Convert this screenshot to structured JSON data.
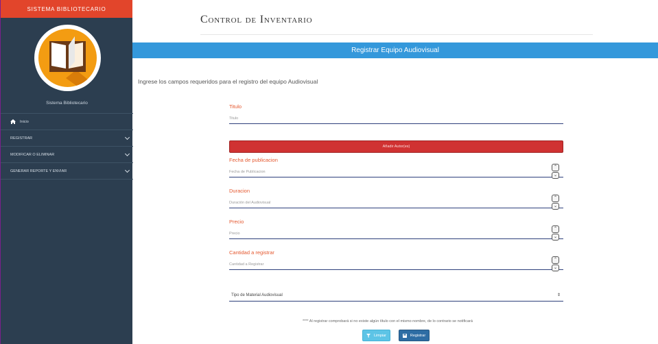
{
  "sidebar": {
    "header": "SISTEMA BIBLIOTECARIO",
    "caption": "Sistema Bibliotecario",
    "items": [
      {
        "label": "Inicio"
      },
      {
        "label": "REGISTRAR"
      },
      {
        "label": "MODIFICAR O ELIMINAR"
      },
      {
        "label": "GENERAR REPORTE Y ENVIAR"
      }
    ]
  },
  "header": {
    "title": "Control de Inventario"
  },
  "banner": {
    "title": "Registrar Equipo Audiovisual"
  },
  "form": {
    "intro": "Ingrese los campos requeridos para el registro del equipo Audiovisual",
    "titulo": {
      "label": "Titulo",
      "placeholder": "Titulo"
    },
    "add_author": "Añadir Autor(es)",
    "fecha": {
      "label": "Fecha de publicacion",
      "placeholder": "Fecha de Publicacion"
    },
    "duracion": {
      "label": "Duracion",
      "placeholder": "Duración del Audiovisual"
    },
    "precio": {
      "label": "Precio",
      "placeholder": "Precio"
    },
    "cantidad": {
      "label": "Cantidad a registrar",
      "placeholder": "Cantidad a Registrar"
    },
    "tipo_select": {
      "selected": "Tipo de Material Audiovisual"
    },
    "note": "**** Al registrar comprobará si no existe algún título con el mismo nombre, de lo contrario se notificará",
    "clear_label": "Limpiar",
    "save_label": "Registrar"
  },
  "colors": {
    "sidebar_bg": "#2c3e50",
    "sidebar_header": "#e2452b",
    "banner": "#3498db",
    "label": "#e4572e",
    "danger": "#d03232",
    "info": "#5dc4e6",
    "primary": "#2e6da4"
  },
  "icons": [
    "home-icon",
    "chevron-down-icon",
    "book-logo-icon",
    "filter-icon",
    "save-icon",
    "spinner-up-icon",
    "spinner-down-icon",
    "select-arrows-icon"
  ]
}
